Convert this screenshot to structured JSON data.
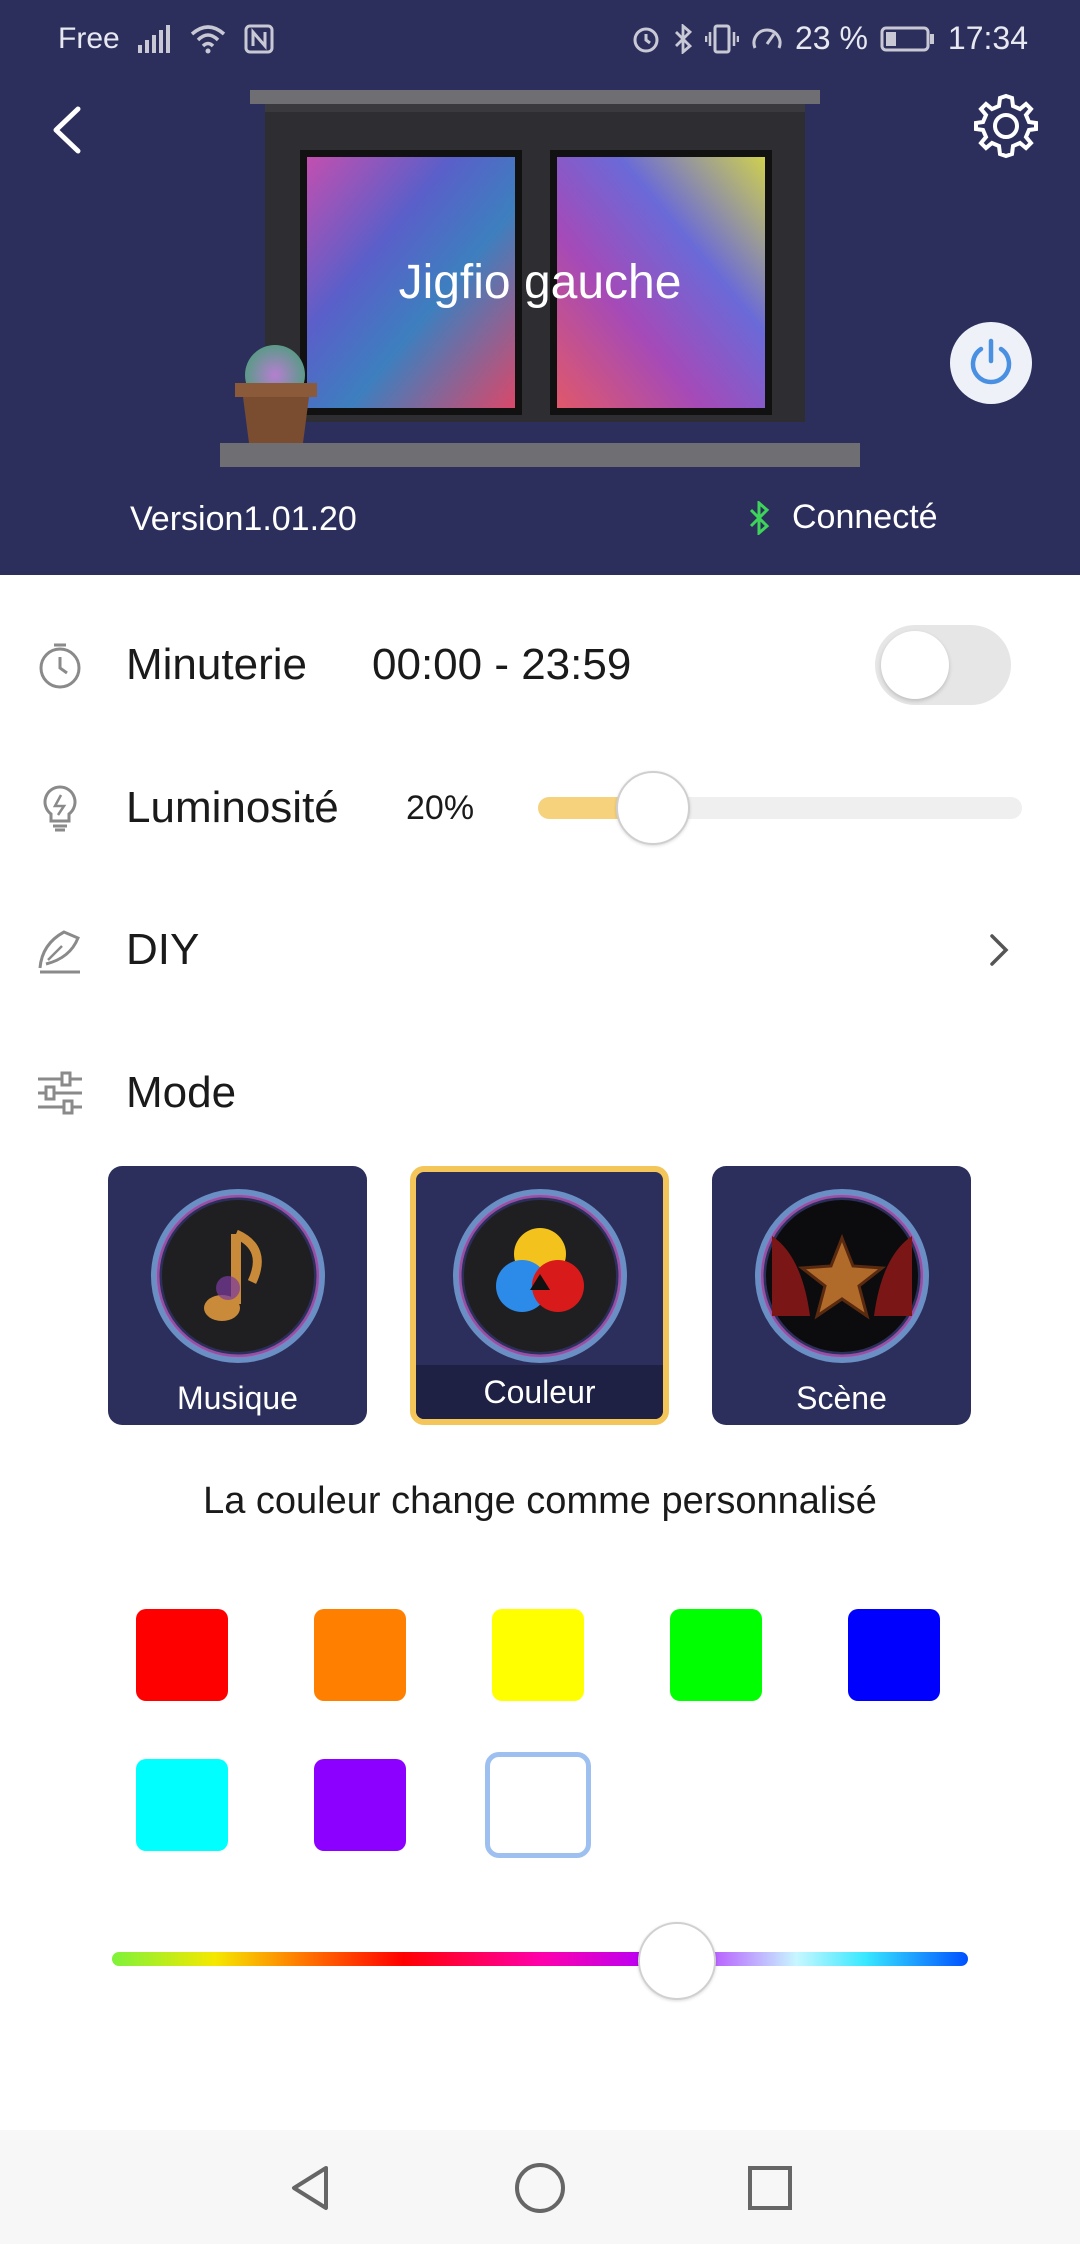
{
  "status_bar": {
    "carrier": "Free",
    "battery": "23 %",
    "time": "17:34",
    "icons": [
      "signal-icon",
      "wifi-icon",
      "nfc-icon",
      "alarm-icon",
      "bluetooth-icon",
      "vibrate-icon",
      "data-saver-icon",
      "battery-icon"
    ]
  },
  "header": {
    "device_name": "Jigfio gauche",
    "version": "Version1.01.20",
    "connection_status": "Connecté",
    "colors": {
      "background": "#2c2f5c",
      "bluetooth": "#3ed35a",
      "power": "#4a90e2"
    }
  },
  "timer": {
    "label": "Minuterie",
    "range": "00:00 - 23:59",
    "enabled": false
  },
  "brightness": {
    "label": "Luminosité",
    "value_text": "20%",
    "value": 0.2
  },
  "diy": {
    "label": "DIY"
  },
  "mode": {
    "label": "Mode",
    "tiles": [
      {
        "label": "Musique",
        "icon": "music-note-icon",
        "selected": false
      },
      {
        "label": "Couleur",
        "icon": "rgb-circles-icon",
        "selected": true
      },
      {
        "label": "Scène",
        "icon": "theater-star-icon",
        "selected": false
      }
    ]
  },
  "color_section": {
    "description": "La couleur change comme personnalisé",
    "swatches": [
      "#ff0000",
      "#ff7f00",
      "#ffff00",
      "#00ff00",
      "#0000ff",
      "#00ffff",
      "#8b00ff",
      "empty"
    ],
    "hue_position": 0.66
  },
  "nav": {
    "icons": [
      "nav-back-icon",
      "nav-home-icon",
      "nav-recents-icon"
    ]
  }
}
